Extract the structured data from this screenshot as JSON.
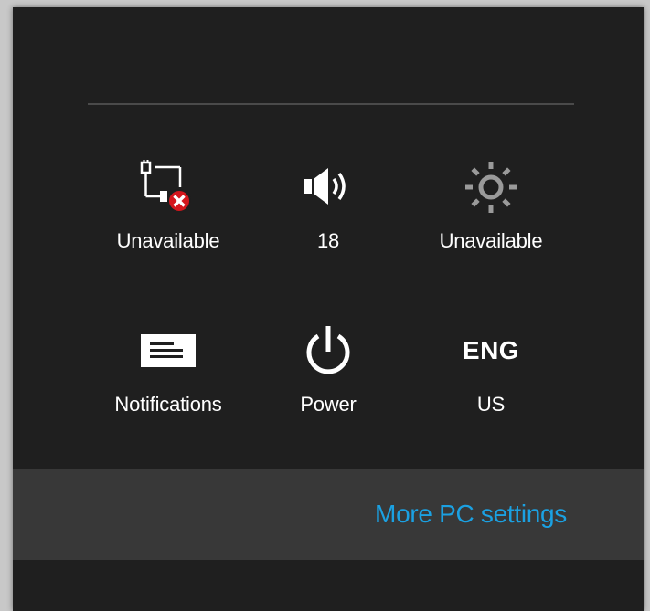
{
  "settings_panel": {
    "tiles": [
      {
        "icon": "network-unavailable-icon",
        "label": "Unavailable"
      },
      {
        "icon": "volume-icon",
        "label": "18"
      },
      {
        "icon": "brightness-icon",
        "label": "Unavailable"
      },
      {
        "icon": "notifications-icon",
        "label": "Notifications"
      },
      {
        "icon": "power-icon",
        "label": "Power"
      },
      {
        "icon": "keyboard-language-icon",
        "code": "ENG",
        "label": "US"
      }
    ],
    "more_settings_link": "More PC settings"
  },
  "colors": {
    "panel_background": "#1f1f1f",
    "bottom_bar": "#383838",
    "link": "#1ba1e2",
    "error_badge": "#d4161c",
    "text": "#ffffff"
  }
}
